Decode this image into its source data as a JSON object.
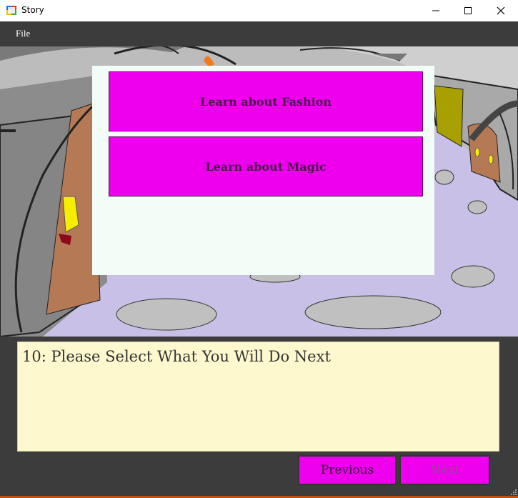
{
  "window": {
    "title": "Story"
  },
  "menu": {
    "file": "File"
  },
  "choices": {
    "fashion": "Learn about Fashion",
    "magic": "Learn about Magic"
  },
  "story": {
    "text": "10: Please Select What You Will Do Next"
  },
  "nav": {
    "previous": "Previous",
    "next": "Next",
    "next_enabled": false
  },
  "colors": {
    "choice_button": "#ee00ee",
    "story_bg": "#fef8cf",
    "overlay_bg": "#f3fdf7",
    "floor": "#c8c0e6",
    "chrome": "#3c3c3c"
  },
  "icons": [
    "app-icon",
    "minimize-icon",
    "maximize-icon",
    "close-icon",
    "resize-grip-icon"
  ]
}
